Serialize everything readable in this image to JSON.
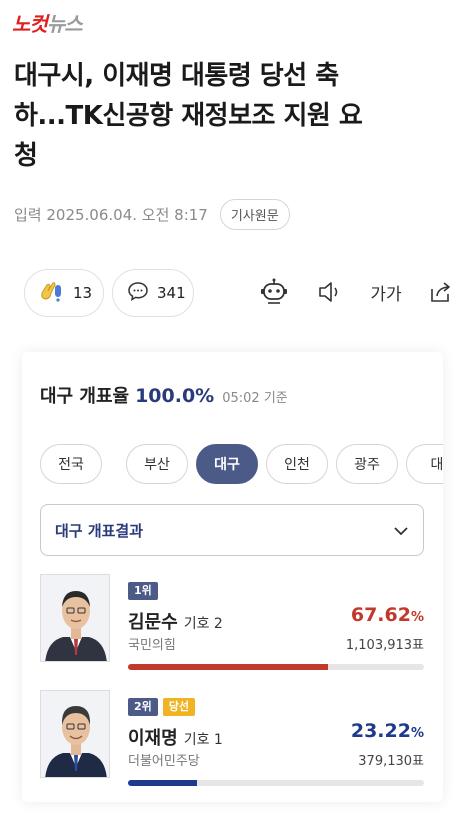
{
  "logo": {
    "part_a": "노컷",
    "part_b": "뉴스"
  },
  "article": {
    "title_line1": "대구시, 이재명 대통령 당선 축",
    "title_line2": "하...TK신공항 재정보조 지원 요",
    "title_line3": "청",
    "date": "입력 2025.06.04. 오전 8:17",
    "origin_label": "기사원문"
  },
  "actions": {
    "reaction_count": "13",
    "comment_count": "341",
    "font_size_label": "가가",
    "icons": [
      "clap-icon",
      "comment-icon",
      "robot-icon",
      "speaker-icon",
      "font-size-icon",
      "share-icon"
    ]
  },
  "election": {
    "title": "대구 개표율",
    "percent": "100.0%",
    "time": "05:02 기준",
    "regions": [
      "전국",
      "부산",
      "대구",
      "인천",
      "광주",
      "대"
    ],
    "active_region": "대구",
    "select_label": "대구 개표결과",
    "candidates": [
      {
        "rank": "1위",
        "elected": "",
        "name": "김문수",
        "number": "기호 2",
        "party": "국민의힘",
        "percent_value": "67.62",
        "percent_unit": "%",
        "votes": "1,103,913표",
        "share": 67.62,
        "color": "#c0392b"
      },
      {
        "rank": "2위",
        "elected": "당선",
        "name": "이재명",
        "number": "기호 1",
        "party": "더불어민주당",
        "percent_value": "23.22",
        "percent_unit": "%",
        "votes": "379,130표",
        "share": 23.22,
        "color": "#1f3a8a"
      }
    ]
  }
}
